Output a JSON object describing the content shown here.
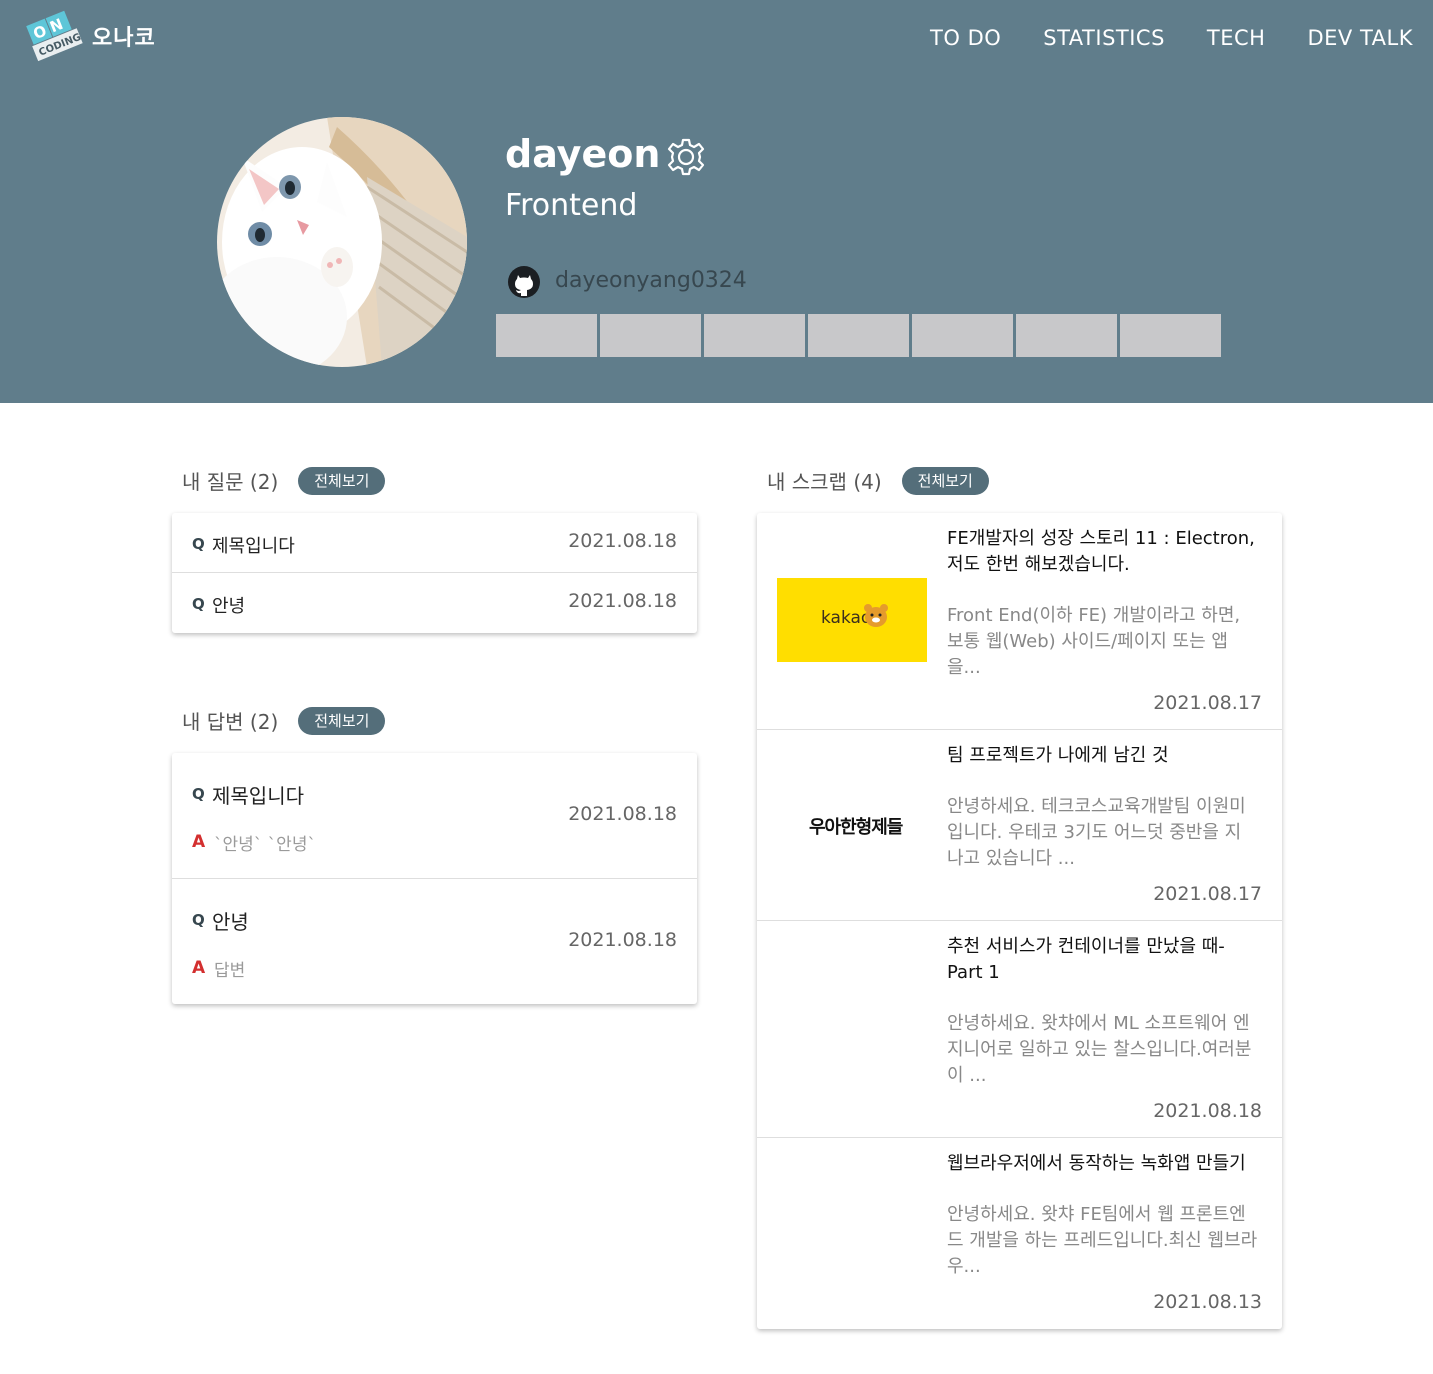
{
  "header": {
    "logo_badge_top": "O N",
    "logo_badge_bottom": "CODING",
    "logo_name": "오나코",
    "nav": [
      "TO DO",
      "STATISTICS",
      "TECH",
      "DEV TALK"
    ]
  },
  "profile": {
    "username": "dayeon",
    "role": "Frontend",
    "github": "dayeonyang0324",
    "contribution_cells": 7
  },
  "questions": {
    "title": "내 질문 (2)",
    "view_all": "전체보기",
    "items": [
      {
        "q": "Q",
        "title": "제목입니다",
        "date": "2021.08.18"
      },
      {
        "q": "Q",
        "title": "안녕",
        "date": "2021.08.18"
      }
    ]
  },
  "answers": {
    "title": "내 답변 (2)",
    "view_all": "전체보기",
    "items": [
      {
        "q": "Q",
        "title": "제목입니다",
        "a": "A",
        "answer": "`안녕` `안녕`",
        "date": "2021.08.18"
      },
      {
        "q": "Q",
        "title": "안녕",
        "a": "A",
        "answer": "답변",
        "date": "2021.08.18"
      }
    ]
  },
  "scraps": {
    "title": "내 스크랩 (4)",
    "view_all": "전체보기",
    "items": [
      {
        "title_line1": "FE개발자의 성장 스토리 11 : Electron,",
        "title_line2": "저도 한번 해보겠습니다.",
        "body": [
          "Front End(이하 FE) 개발이라고 하면,",
          "보통 웹(Web) 사이드/페이지 또는 앱",
          "을..."
        ],
        "date": "2021.08.17",
        "thumb_text": "kakao"
      },
      {
        "title_line1": "팀 프로젝트가 나에게 남긴 것",
        "title_line2": "",
        "body": [
          "안녕하세요. 테크코스교육개발팀 이원미",
          "입니다. 우테코 3기도 어느덧 중반을 지",
          "나고 있습니다 ..."
        ],
        "date": "2021.08.17",
        "thumb_text": "우아한형제들"
      },
      {
        "title_line1": "추천 서비스가 컨테이너를 만났을 때-",
        "title_line2": "Part 1",
        "body": [
          "안녕하세요. 왓챠에서 ML 소프트웨어 엔",
          "지니어로 일하고 있는 찰스입니다.여러분",
          "이 ..."
        ],
        "date": "2021.08.18",
        "thumb_text": ""
      },
      {
        "title_line1": "웹브라우저에서 동작하는 녹화앱 만들기",
        "title_line2": "",
        "body": [
          "안녕하세요. 왓챠 FE팀에서 웹 프론트엔",
          "드 개발을 하는 프레드입니다.최신 웹브라",
          "우..."
        ],
        "date": "2021.08.13",
        "thumb_text": ""
      }
    ]
  },
  "colors": {
    "header_bg": "#607d8b",
    "pill_bg": "#546e7a",
    "answer_mark": "#d32f2f",
    "kakao_yellow": "#ffde00"
  }
}
